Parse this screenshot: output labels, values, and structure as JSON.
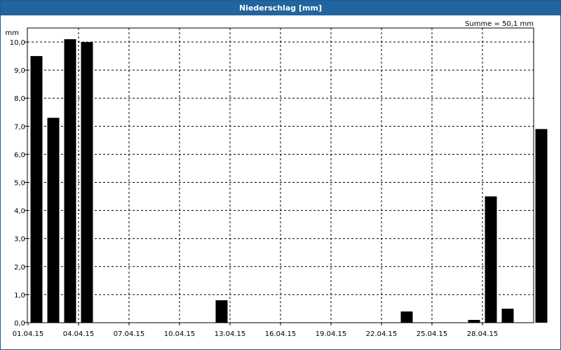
{
  "window": {
    "title": "Niederschlag [mm]"
  },
  "colors": {
    "titlebar": "#21649e",
    "bars": "#000000",
    "grid": "#000000"
  },
  "chart_data": {
    "type": "bar",
    "title": "Niederschlag [mm]",
    "ylabel": "mm",
    "xlabel": "",
    "summary": "Summe = 50,1 mm",
    "ylim": [
      0,
      10.5
    ],
    "grid": true,
    "y_ticks": [
      "0,0",
      "1,0",
      "2,0",
      "3,0",
      "4,0",
      "5,0",
      "6,0",
      "7,0",
      "8,0",
      "9,0",
      "10,0"
    ],
    "x_ticks": [
      "01.04.15",
      "04.04.15",
      "07.04.15",
      "10.04.15",
      "13.04.15",
      "16.04.15",
      "19.04.15",
      "22.04.15",
      "25.04.15",
      "28.04.15"
    ],
    "categories": [
      "01.04.15",
      "02.04.15",
      "03.04.15",
      "04.04.15",
      "05.04.15",
      "06.04.15",
      "07.04.15",
      "08.04.15",
      "09.04.15",
      "10.04.15",
      "11.04.15",
      "12.04.15",
      "13.04.15",
      "14.04.15",
      "15.04.15",
      "16.04.15",
      "17.04.15",
      "18.04.15",
      "19.04.15",
      "20.04.15",
      "21.04.15",
      "22.04.15",
      "23.04.15",
      "24.04.15",
      "25.04.15",
      "26.04.15",
      "27.04.15",
      "28.04.15",
      "29.04.15",
      "30.04.15"
    ],
    "values": [
      9.5,
      7.3,
      10.1,
      10.0,
      0,
      0,
      0,
      0,
      0,
      0,
      0,
      0.8,
      0,
      0,
      0,
      0,
      0,
      0,
      0,
      0,
      0,
      0,
      0.4,
      0,
      0,
      0,
      0.1,
      4.5,
      0.5,
      0,
      6.9
    ]
  }
}
